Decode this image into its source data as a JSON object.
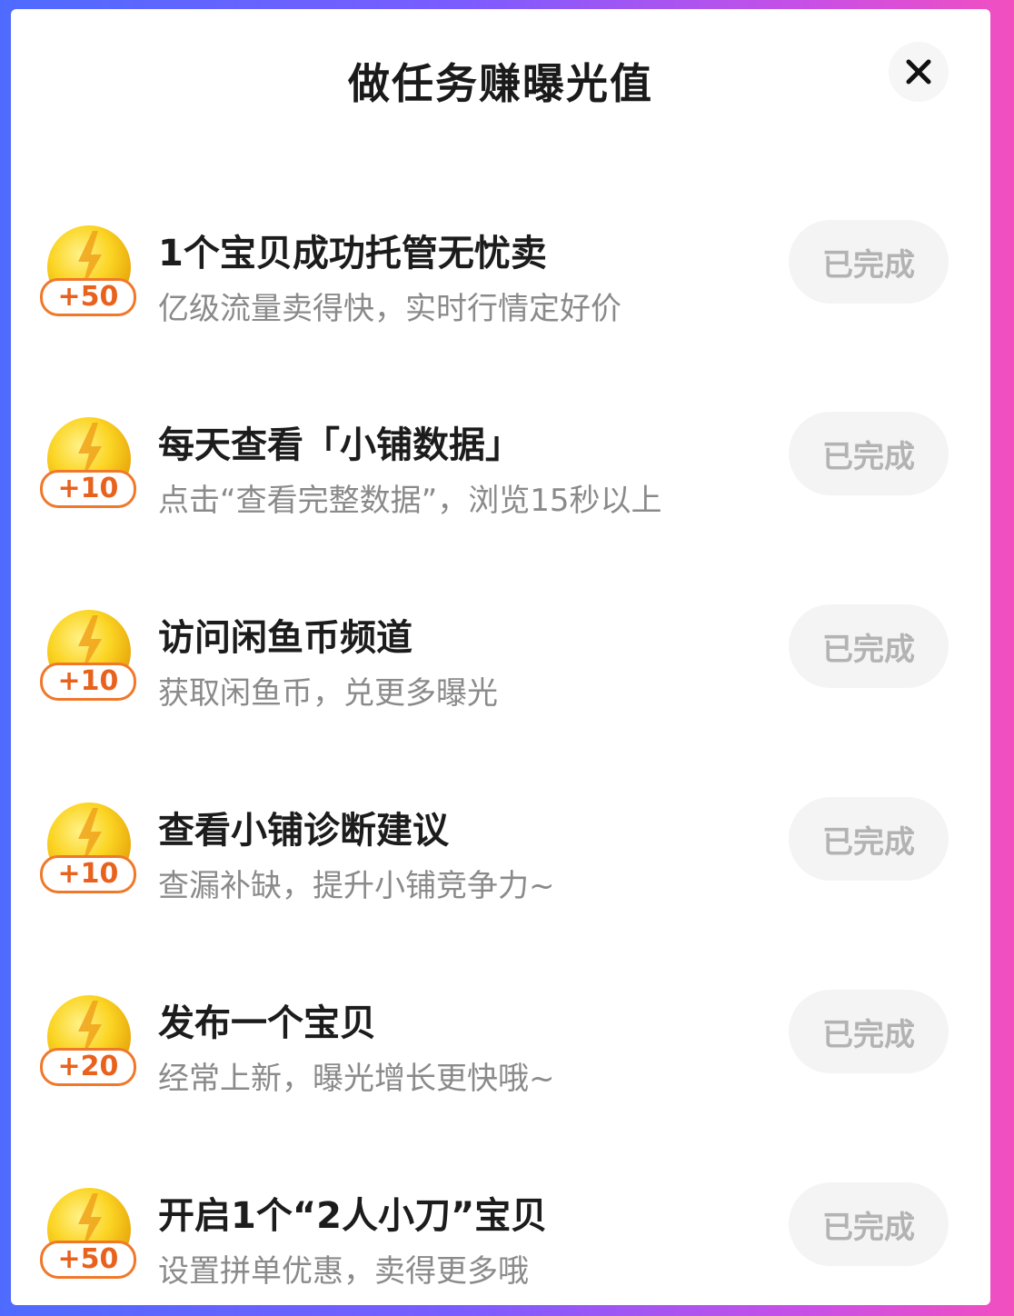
{
  "header": {
    "title": "做任务赚曝光值"
  },
  "tasks": [
    {
      "points": "+50",
      "title": "1个宝贝成功托管无忧卖",
      "desc": "亿级流量卖得快，实时行情定好价",
      "status": "已完成"
    },
    {
      "points": "+10",
      "title": "每天查看「小铺数据」",
      "desc": "点击“查看完整数据”，浏览15秒以上",
      "status": "已完成"
    },
    {
      "points": "+10",
      "title": "访问闲鱼币频道",
      "desc": "获取闲鱼币，兑更多曝光",
      "status": "已完成"
    },
    {
      "points": "+10",
      "title": "查看小铺诊断建议",
      "desc": "查漏补缺，提升小铺竞争力~",
      "status": "已完成"
    },
    {
      "points": "+20",
      "title": "发布一个宝贝",
      "desc": "经常上新，曝光增长更快哦~",
      "status": "已完成"
    },
    {
      "points": "+50",
      "title": "开启1个“2人小刀”宝贝",
      "desc": "设置拼单优惠，卖得更多哦",
      "status": "已完成"
    }
  ],
  "colors": {
    "accent": "#f0782a",
    "coin": "#f7c61a",
    "done_bg": "#f4f4f4",
    "done_text": "#b3b3b3"
  },
  "icons": {
    "close": "close-icon",
    "coin": "lightning-coin-icon"
  }
}
